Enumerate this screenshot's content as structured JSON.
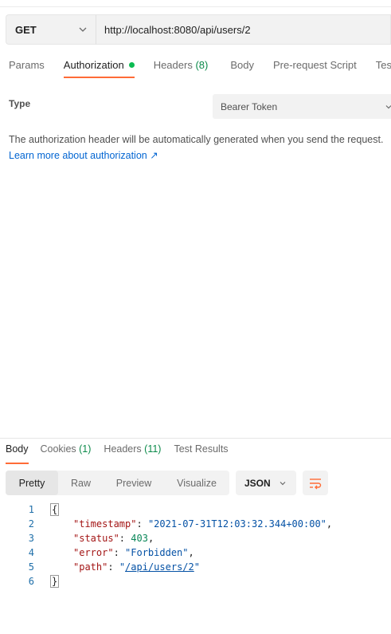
{
  "request": {
    "method": "GET",
    "url": "http://localhost:8080/api/users/2"
  },
  "tabs": [
    {
      "label": "Params"
    },
    {
      "label": "Authorization",
      "active": true,
      "status": "configured"
    },
    {
      "label": "Headers ",
      "count": "(8)"
    },
    {
      "label": "Body"
    },
    {
      "label": "Pre-request Script"
    },
    {
      "label": "Tests"
    }
  ],
  "auth": {
    "type_label": "Type",
    "type_value": "Bearer Token",
    "info": "The authorization header will be automatically generated when you send the request.",
    "learn_more": "Learn more about authorization ↗"
  },
  "response": {
    "tabs": [
      {
        "label": "Body",
        "active": true
      },
      {
        "label": "Cookies ",
        "count": "(1)"
      },
      {
        "label": "Headers ",
        "count": "(11)"
      },
      {
        "label": "Test Results"
      }
    ],
    "views": [
      "Pretty",
      "Raw",
      "Preview",
      "Visualize"
    ],
    "active_view": "Pretty",
    "format": "JSON",
    "line_numbers": [
      "1",
      "2",
      "3",
      "4",
      "5",
      "6"
    ],
    "body": {
      "open": "{",
      "close": "}",
      "k_timestamp": "\"timestamp\"",
      "v_timestamp": "\"2021-07-31T12:03:32.344+00:00\"",
      "k_status": "\"status\"",
      "v_status": "403",
      "k_error": "\"error\"",
      "v_error": "\"Forbidden\"",
      "k_path": "\"path\"",
      "v_path_q1": "\"",
      "v_path": "/api/users/2",
      "v_path_q2": "\""
    }
  },
  "colors": {
    "accent": "#ff6c37",
    "status_dot": "#0cbb52",
    "count": "#0b8a4a",
    "link": "#0265d2"
  }
}
